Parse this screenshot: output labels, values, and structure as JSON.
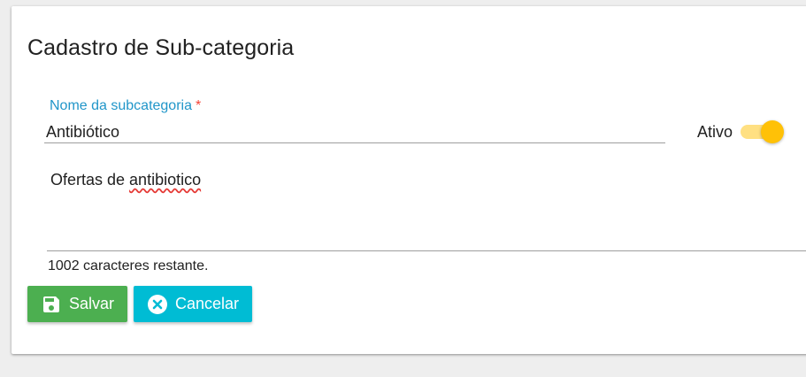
{
  "form": {
    "title": "Cadastro de Sub-categoria",
    "name_field": {
      "label": "Nome da subcategoria",
      "required_mark": "*",
      "value": "Antibiótico"
    },
    "active_toggle": {
      "label": "Ativo",
      "checked": true,
      "accent_color": "#ffc107"
    },
    "description": {
      "value_prefix": "Ofertas de ",
      "value_misspelled": "antibiotico",
      "remaining_text": "1002 caracteres restante."
    },
    "buttons": {
      "save": {
        "label": "Salvar",
        "icon": "floppy-disk-icon",
        "color": "#4caf50"
      },
      "cancel": {
        "label": "Cancelar",
        "icon": "close-circle-icon",
        "color": "#00bcd4"
      }
    }
  }
}
